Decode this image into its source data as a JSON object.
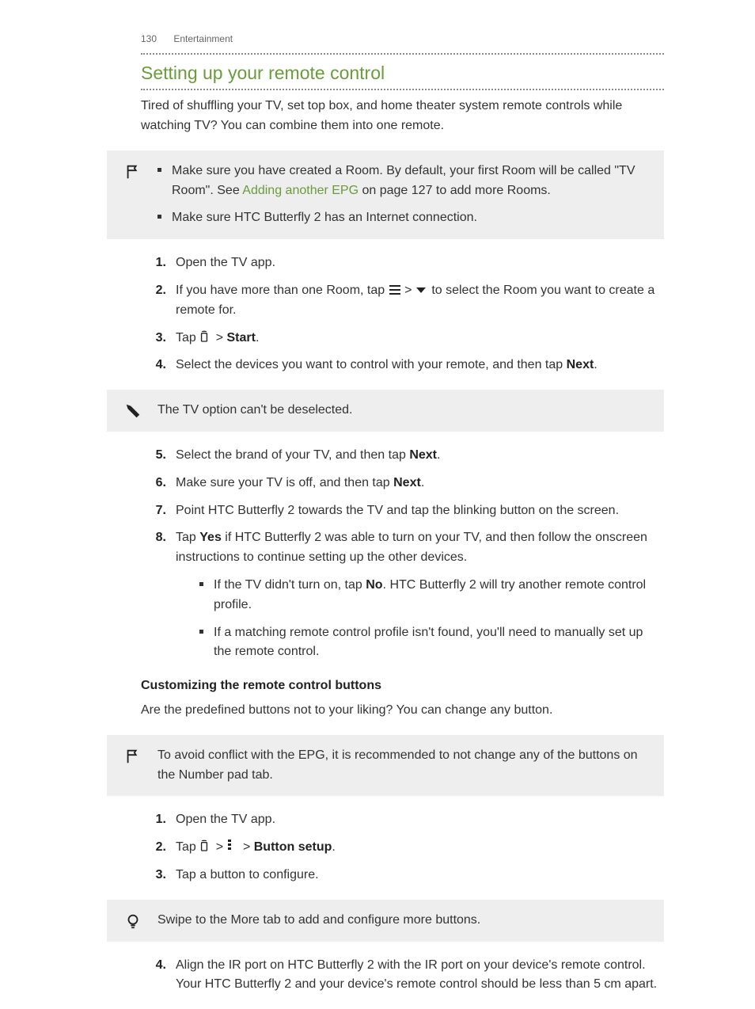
{
  "header": {
    "page_number": "130",
    "section": "Entertainment"
  },
  "title": "Setting up your remote control",
  "intro": "Tired of shuffling your TV, set top box, and home theater system remote controls while watching TV? You can combine them into one remote.",
  "callout1": {
    "icon": "flag-icon",
    "bullets": [
      {
        "pre": "Make sure you have created a Room. By default, your first Room will be called \"TV Room\". See ",
        "link": "Adding another EPG",
        "post": " on page 127 to add more Rooms."
      },
      {
        "pre": "Make sure HTC Butterfly 2 has an Internet connection.",
        "link": "",
        "post": ""
      }
    ]
  },
  "steps1": {
    "s1": "Open the TV app.",
    "s2_pre": "If you have more than one Room, tap ",
    "s2_mid": " > ",
    "s2_post": " to select the Room you want to create a remote for.",
    "s3_pre": "Tap ",
    "s3_sep": " > ",
    "s3_bold": "Start",
    "s3_end": ".",
    "s4_pre": "Select the devices you want to control with your remote, and then tap ",
    "s4_bold": "Next",
    "s4_end": "."
  },
  "callout2": {
    "icon": "pen-icon",
    "text": "The TV option can't be deselected."
  },
  "steps2": {
    "s5_pre": "Select the brand of your TV, and then tap ",
    "s5_bold": "Next",
    "s5_end": ".",
    "s6_pre": "Make sure your TV is off, and then tap ",
    "s6_bold": "Next",
    "s6_end": ".",
    "s7": "Point HTC Butterfly 2 towards the TV and tap the blinking button on the screen.",
    "s8_pre": "Tap ",
    "s8_bold": "Yes",
    "s8_post": " if HTC Butterfly 2 was able to turn on your TV, and then follow the onscreen instructions to continue setting up the other devices.",
    "s8_bul1_pre": "If the TV didn't turn on, tap ",
    "s8_bul1_bold": "No",
    "s8_bul1_post": ". HTC Butterfly 2 will try another remote control profile.",
    "s8_bul2": "If a matching remote control profile isn't found, you'll need to manually set up the remote control."
  },
  "subhead": "Customizing the remote control buttons",
  "sub_intro": "Are the predefined buttons not to your liking? You can change any button.",
  "callout3": {
    "icon": "flag-icon",
    "text": "To avoid conflict with the EPG, it is recommended to not change any of the buttons on the Number pad tab."
  },
  "steps3": {
    "s1": "Open the TV app.",
    "s2_pre": "Tap ",
    "s2_sep": " > ",
    "s2_sep2": " > ",
    "s2_bold": "Button setup",
    "s2_end": ".",
    "s3": "Tap a button to configure."
  },
  "callout4": {
    "icon": "bulb-icon",
    "text": "Swipe to the More tab to add and configure more buttons."
  },
  "steps4": {
    "s4": "Align the IR port on HTC Butterfly 2 with the IR port on your device's remote control. Your HTC Butterfly 2 and your device's remote control should be less than 5 cm apart."
  }
}
